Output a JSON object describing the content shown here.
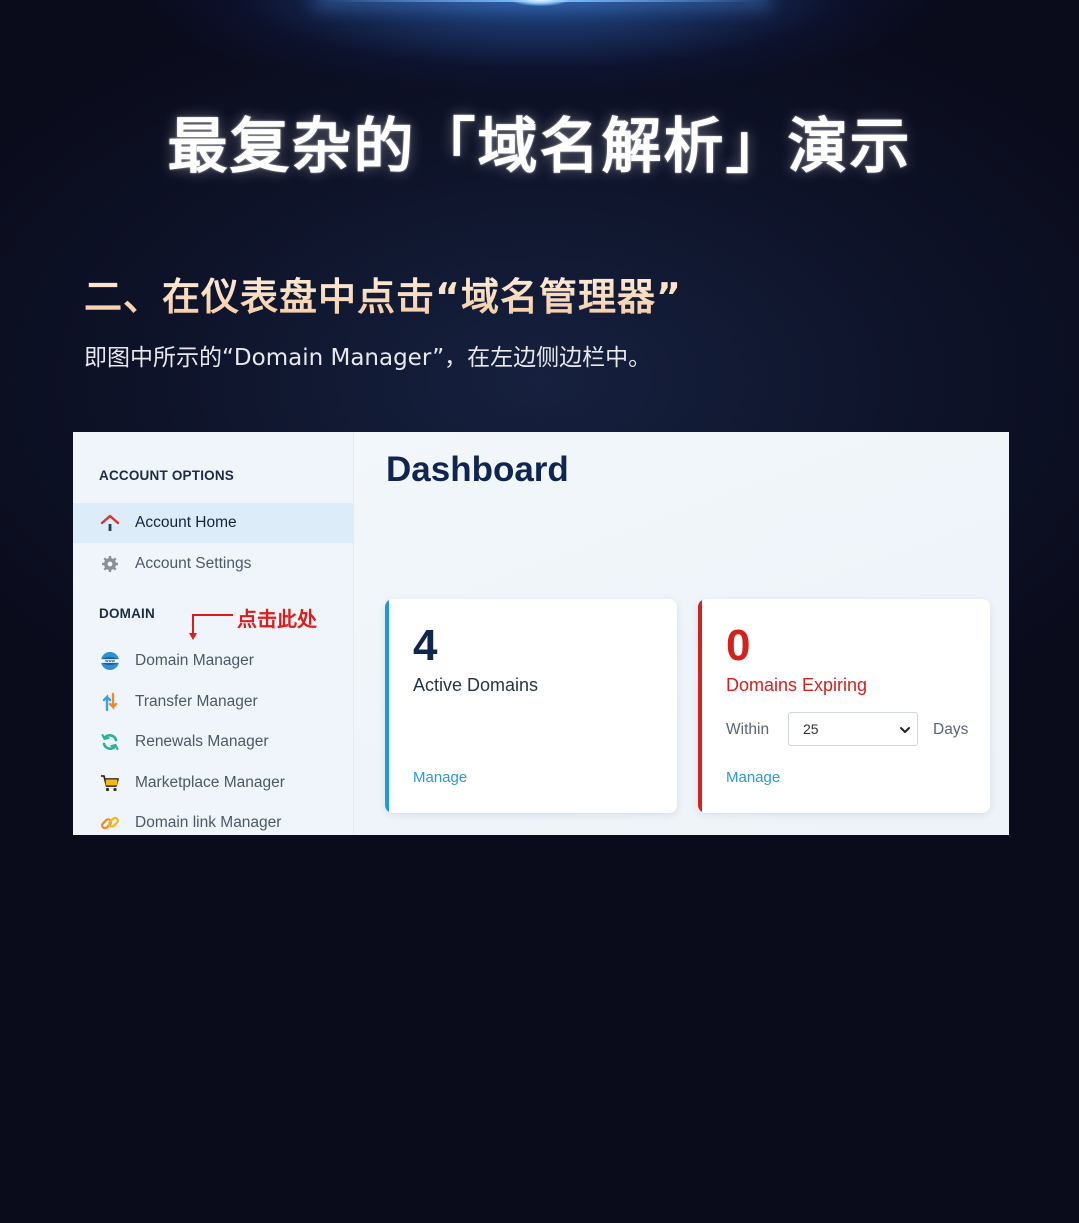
{
  "hero": {
    "title": "最复杂的「域名解析」演示"
  },
  "step": {
    "title": "二、在仪表盘中点击“域名管理器”",
    "description": "即图中所示的“Domain Manager”，在左边侧边栏中。"
  },
  "screenshot": {
    "sidebar": {
      "account_section_label": "ACCOUNT OPTIONS",
      "account_items": [
        {
          "label": "Account Home",
          "icon": "home-icon",
          "active": true
        },
        {
          "label": "Account Settings",
          "icon": "gear-icon",
          "active": false
        }
      ],
      "domain_section_label": "DOMAIN",
      "annotation": "点击此处",
      "domain_items": [
        {
          "label": "Domain Manager",
          "icon": "www-globe-icon"
        },
        {
          "label": "Transfer Manager",
          "icon": "transfer-arrows-icon"
        },
        {
          "label": "Renewals Manager",
          "icon": "refresh-icon"
        },
        {
          "label": "Marketplace Manager",
          "icon": "cart-icon"
        },
        {
          "label": "Domain link Manager",
          "icon": "link-icon"
        }
      ]
    },
    "main": {
      "title": "Dashboard",
      "cards": [
        {
          "count": "4",
          "label": "Active Domains",
          "link": "Manage",
          "accent_color": "#1e9bd7"
        },
        {
          "count": "0",
          "label": "Domains Expiring",
          "within_label": "Within",
          "select_value": "25",
          "days_label": "Days",
          "link": "Manage",
          "accent_color": "#d3221d"
        }
      ]
    }
  },
  "colors": {
    "background": "#0a0b1b",
    "step_title": "#f3c9a0",
    "annotation": "#e01b1b",
    "title_navy": "#102550"
  }
}
